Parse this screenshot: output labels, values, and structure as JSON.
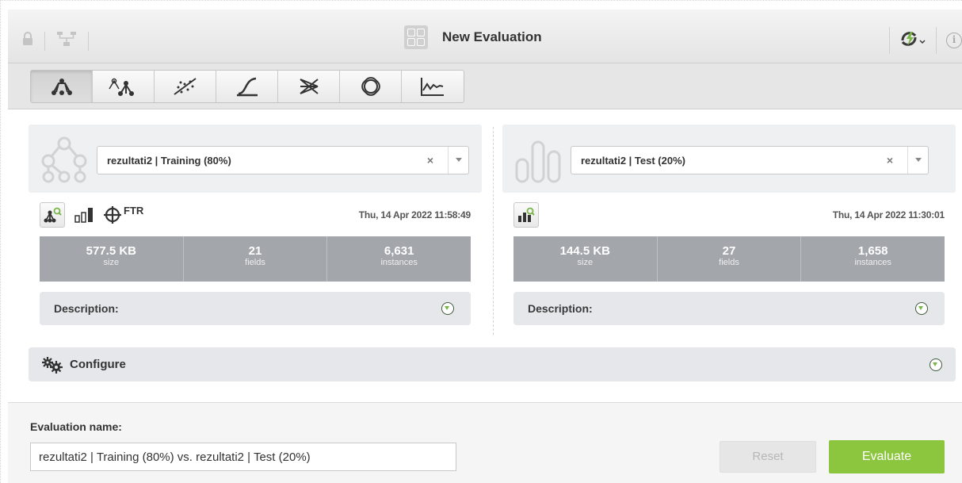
{
  "header": {
    "title": "New Evaluation",
    "icons": [
      "lock-icon",
      "network-icon",
      "evaluation-icon",
      "sync-icon",
      "info-icon"
    ],
    "info_glyph": "i"
  },
  "toolbar": {
    "tools": [
      {
        "name": "model-tool",
        "active": true
      },
      {
        "name": "ensemble-tool",
        "active": false
      },
      {
        "name": "linear-regression-tool",
        "active": false
      },
      {
        "name": "logistic-regression-tool",
        "active": false
      },
      {
        "name": "deepnet-tool",
        "active": false
      },
      {
        "name": "fusion-tool",
        "active": false
      },
      {
        "name": "time-series-tool",
        "active": false
      }
    ]
  },
  "left_panel": {
    "selected": "rezultati2 | Training (80%)",
    "clear_glyph": "×",
    "ftr_label": "FTR",
    "date": "Thu, 14 Apr 2022 11:58:49",
    "stats": [
      {
        "value": "577.5 KB",
        "label": "size"
      },
      {
        "value": "21",
        "label": "fields"
      },
      {
        "value": "6,631",
        "label": "instances"
      }
    ],
    "description_label": "Description:"
  },
  "right_panel": {
    "selected": "rezultati2 | Test (20%)",
    "clear_glyph": "×",
    "date": "Thu, 14 Apr 2022 11:30:01",
    "stats": [
      {
        "value": "144.5 KB",
        "label": "size"
      },
      {
        "value": "27",
        "label": "fields"
      },
      {
        "value": "1,658",
        "label": "instances"
      }
    ],
    "description_label": "Description:"
  },
  "configure": {
    "label": "Configure"
  },
  "footer": {
    "name_label": "Evaluation name:",
    "name_value": "rezultati2 | Training (80%) vs. rezultati2 | Test (20%)",
    "reset_label": "Reset",
    "evaluate_label": "Evaluate"
  },
  "colors": {
    "accent_green": "#8cc63f",
    "stats_bg": "#a3a6aa",
    "panel_bg": "#eff0f2"
  }
}
